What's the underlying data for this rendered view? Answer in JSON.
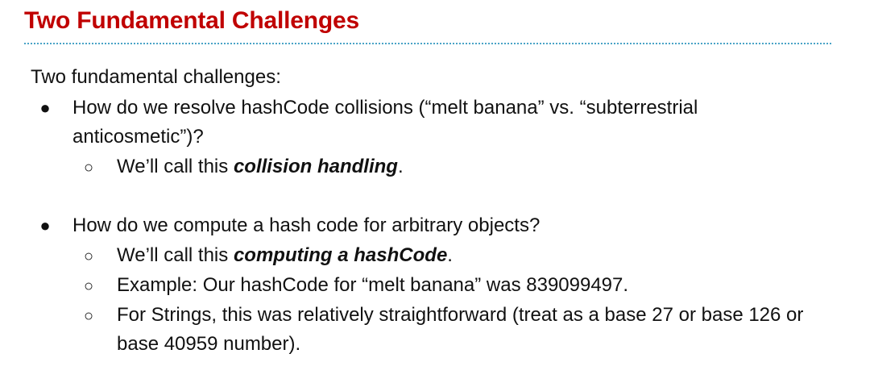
{
  "slide": {
    "title": "Two Fundamental Challenges"
  },
  "content": {
    "intro": "Two fundamental challenges:",
    "bullet_symbol": "●",
    "sub_symbol": "○",
    "bullets": [
      {
        "text": "How do we resolve hashCode collisions (“melt banana” vs. “subterrestrial anticosmetic”)?",
        "subs": [
          {
            "prefix": "We’ll call this ",
            "emph": "collision handling",
            "suffix": "."
          }
        ]
      },
      {
        "text": "How do we compute a hash code for arbitrary objects?",
        "subs": [
          {
            "prefix": "We’ll call this ",
            "emph": "computing a hashCode",
            "suffix": "."
          },
          {
            "text": "Example: Our hashCode for “melt banana” was 839099497."
          },
          {
            "text": "For Strings, this was relatively straightforward (treat as a base 27 or base 126 or base 40959 number)."
          }
        ]
      }
    ]
  }
}
